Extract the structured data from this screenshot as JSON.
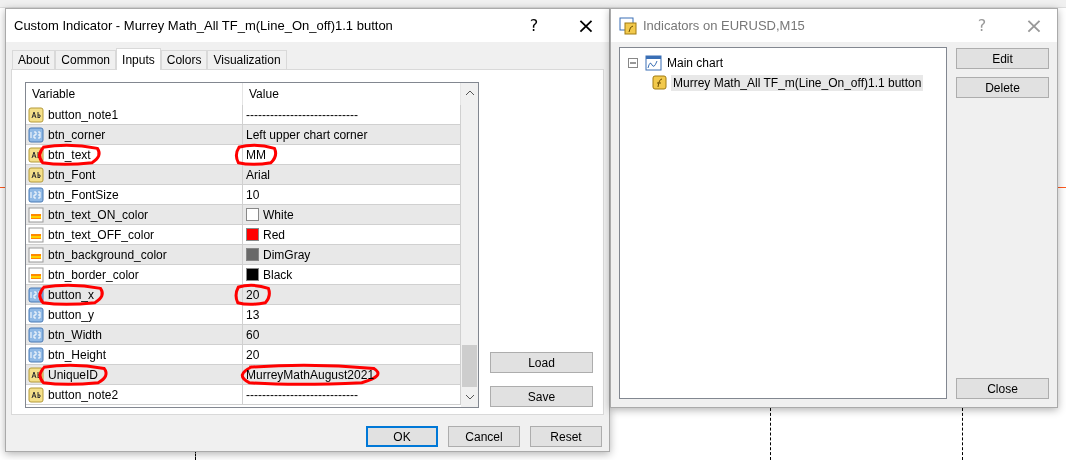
{
  "dialog": {
    "title": "Custom Indicator - Murrey Math_All TF_m(Line_On_off)1.1 button",
    "help": "?",
    "close": "×",
    "tabs": [
      {
        "label": "About",
        "selected": false
      },
      {
        "label": "Common",
        "selected": false
      },
      {
        "label": "Inputs",
        "selected": true
      },
      {
        "label": "Colors",
        "selected": false
      },
      {
        "label": "Visualization",
        "selected": false
      }
    ],
    "table": {
      "columns": [
        "Variable",
        "Value"
      ],
      "rows": [
        {
          "kind": "string",
          "name": "button_note1",
          "value": "----------------------------",
          "name_circled": false,
          "value_circled": false
        },
        {
          "kind": "int",
          "name": "btn_corner",
          "value": "Left upper chart corner",
          "name_circled": false,
          "value_circled": false
        },
        {
          "kind": "string",
          "name": "btn_text",
          "value": "MM",
          "name_circled": true,
          "value_circled": true
        },
        {
          "kind": "string",
          "name": "btn_Font",
          "value": "Arial",
          "name_circled": false,
          "value_circled": false
        },
        {
          "kind": "int",
          "name": "btn_FontSize",
          "value": "10",
          "name_circled": false,
          "value_circled": false
        },
        {
          "kind": "color",
          "name": "btn_text_ON_color",
          "value": "White",
          "color": "#ffffff",
          "name_circled": false,
          "value_circled": false
        },
        {
          "kind": "color",
          "name": "btn_text_OFF_color",
          "value": "Red",
          "color": "#ff0000",
          "name_circled": false,
          "value_circled": false
        },
        {
          "kind": "color",
          "name": "btn_background_color",
          "value": "DimGray",
          "color": "#696969",
          "name_circled": false,
          "value_circled": false
        },
        {
          "kind": "color",
          "name": "btn_border_color",
          "value": "Black",
          "color": "#000000",
          "name_circled": false,
          "value_circled": false
        },
        {
          "kind": "int",
          "name": "button_x",
          "value": "20",
          "name_circled": true,
          "value_circled": true
        },
        {
          "kind": "int",
          "name": "button_y",
          "value": "13",
          "name_circled": false,
          "value_circled": false
        },
        {
          "kind": "int",
          "name": "btn_Width",
          "value": "60",
          "name_circled": false,
          "value_circled": false
        },
        {
          "kind": "int",
          "name": "btn_Height",
          "value": "20",
          "name_circled": false,
          "value_circled": false
        },
        {
          "kind": "string",
          "name": "UniqueID",
          "value": "MurreyMathAugust2021",
          "name_circled": true,
          "value_circled": true
        },
        {
          "kind": "string",
          "name": "button_note2",
          "value": "----------------------------",
          "name_circled": false,
          "value_circled": false
        }
      ]
    },
    "side_buttons": [
      "Load",
      "Save"
    ],
    "footer_buttons": [
      {
        "label": "OK",
        "selected": true
      },
      {
        "label": "Cancel",
        "selected": false
      },
      {
        "label": "Reset",
        "selected": false
      }
    ]
  },
  "indicators": {
    "title": "Indicators on EURUSD,M15",
    "help": "?",
    "close": "×",
    "tree": [
      {
        "label": "Main chart",
        "expanded": true,
        "children": [
          {
            "label": "Murrey Math_All TF_m(Line_On_off)1.1 button",
            "selected": true
          }
        ]
      }
    ],
    "buttons": [
      "Edit",
      "Delete"
    ],
    "close_button": "Close"
  }
}
